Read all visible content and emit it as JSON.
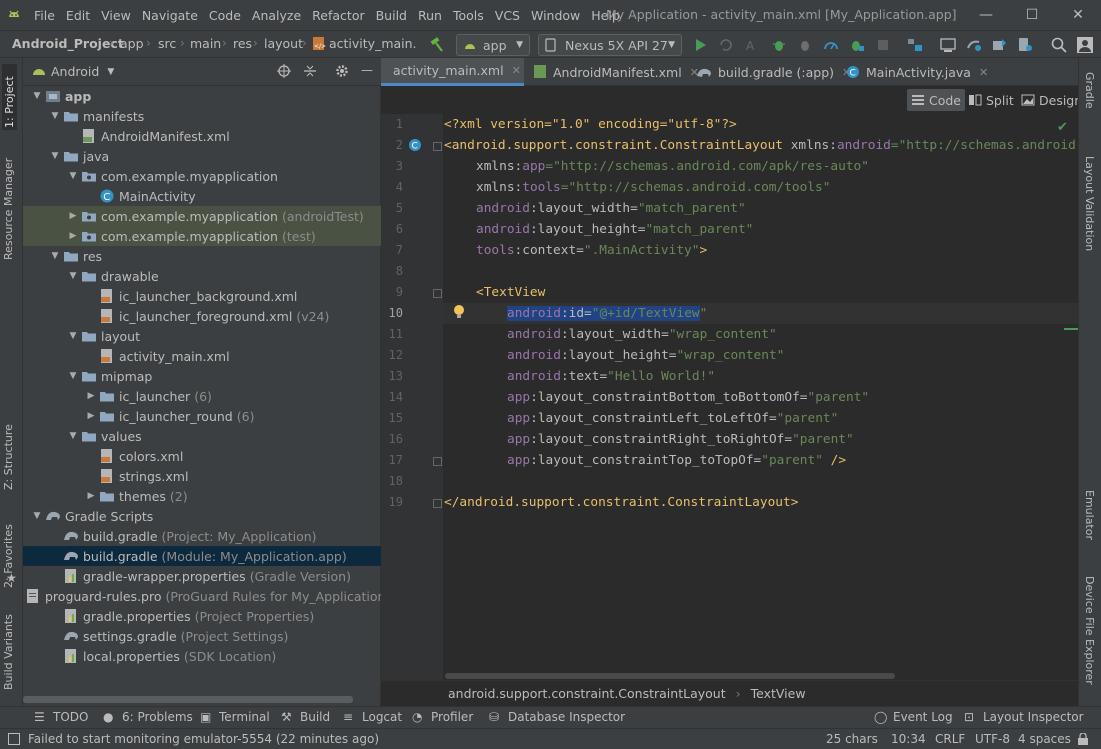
{
  "menu": [
    "File",
    "Edit",
    "View",
    "Navigate",
    "Code",
    "Analyze",
    "Refactor",
    "Build",
    "Run",
    "Tools",
    "VCS",
    "Window",
    "Help"
  ],
  "window_title": "My Application - activity_main.xml [My_Application.app]",
  "window_controls": {
    "minimize": "—",
    "maximize": "☐",
    "close": "✕"
  },
  "breadcrumb": [
    "Android_Project",
    "app",
    "src",
    "main",
    "res",
    "layout",
    "activity_main.xml"
  ],
  "run_config": "app",
  "device": "Nexus 5X API 27",
  "project_view": "Android",
  "left_tabs": [
    "1: Project",
    "Resource Manager",
    "Z: Structure",
    "2: Favorites",
    "Build Variants"
  ],
  "right_tabs": [
    "Gradle",
    "Layout Validation",
    "Emulator",
    "Device File Explorer"
  ],
  "tree": [
    {
      "label": "app",
      "suffix": "",
      "icon": "module",
      "expanded": true
    },
    {
      "label": "manifests",
      "suffix": "",
      "icon": "folder",
      "expanded": true
    },
    {
      "label": "AndroidManifest.xml",
      "suffix": "",
      "icon": "manifest"
    },
    {
      "label": "java",
      "suffix": "",
      "icon": "folder",
      "expanded": true
    },
    {
      "label": "com.example.myapplication",
      "suffix": "",
      "icon": "package",
      "expanded": true
    },
    {
      "label": "MainActivity",
      "suffix": "",
      "icon": "class"
    },
    {
      "label": "com.example.myapplication",
      "suffix": "(androidTest)",
      "icon": "package",
      "expanded": false
    },
    {
      "label": "com.example.myapplication",
      "suffix": "(test)",
      "icon": "package",
      "expanded": false
    },
    {
      "label": "res",
      "suffix": "",
      "icon": "folder",
      "expanded": true
    },
    {
      "label": "drawable",
      "suffix": "",
      "icon": "folder",
      "expanded": true
    },
    {
      "label": "ic_launcher_background.xml",
      "suffix": "",
      "icon": "xml"
    },
    {
      "label": "ic_launcher_foreground.xml",
      "suffix": "(v24)",
      "icon": "xml"
    },
    {
      "label": "layout",
      "suffix": "",
      "icon": "folder",
      "expanded": true
    },
    {
      "label": "activity_main.xml",
      "suffix": "",
      "icon": "xml"
    },
    {
      "label": "mipmap",
      "suffix": "",
      "icon": "folder",
      "expanded": true
    },
    {
      "label": "ic_launcher",
      "suffix": "(6)",
      "icon": "folder",
      "expanded": false
    },
    {
      "label": "ic_launcher_round",
      "suffix": "(6)",
      "icon": "folder",
      "expanded": false
    },
    {
      "label": "values",
      "suffix": "",
      "icon": "folder",
      "expanded": true
    },
    {
      "label": "colors.xml",
      "suffix": "",
      "icon": "xml"
    },
    {
      "label": "strings.xml",
      "suffix": "",
      "icon": "xml"
    },
    {
      "label": "themes",
      "suffix": "(2)",
      "icon": "folder",
      "expanded": false
    },
    {
      "label": "Gradle Scripts",
      "suffix": "",
      "icon": "gradle",
      "expanded": true
    },
    {
      "label": "build.gradle",
      "suffix": "(Project: My_Application)",
      "icon": "gradle"
    },
    {
      "label": "build.gradle",
      "suffix": "(Module: My_Application.app)",
      "icon": "gradle"
    },
    {
      "label": "gradle-wrapper.properties",
      "suffix": "(Gradle Version)",
      "icon": "props"
    },
    {
      "label": "proguard-rules.pro",
      "suffix": "(ProGuard Rules for My_Application",
      "icon": "file"
    },
    {
      "label": "gradle.properties",
      "suffix": "(Project Properties)",
      "icon": "props"
    },
    {
      "label": "settings.gradle",
      "suffix": "(Project Settings)",
      "icon": "gradle"
    },
    {
      "label": "local.properties",
      "suffix": "(SDK Location)",
      "icon": "props"
    }
  ],
  "editor_tabs": [
    {
      "label": "activity_main.xml",
      "active": true
    },
    {
      "label": "AndroidManifest.xml",
      "active": false
    },
    {
      "label": "build.gradle (:app)",
      "active": false
    },
    {
      "label": "MainActivity.java",
      "active": false
    }
  ],
  "editor_modes": [
    "Code",
    "Split",
    "Design"
  ],
  "code_lines": [
    "1",
    "2",
    "3",
    "4",
    "5",
    "6",
    "7",
    "8",
    "9",
    "10",
    "11",
    "12",
    "13",
    "14",
    "15",
    "16",
    "17",
    "18",
    "19"
  ],
  "code": {
    "pi": "<?xml version=\"1.0\" encoding=\"utf-8\"?>",
    "root_tag": "<android.support.constraint.ConstraintLayout",
    "root_xmlns": " xmlns:",
    "ns_android": "android",
    "eq_android": "=\"http://schemas.android.com/apk/res/android\"",
    "l3a": "xmlns:",
    "l3b": "app",
    "l3c": "=\"http://schemas.android.com/apk/res-auto\"",
    "l4a": "xmlns:",
    "l4b": "tools",
    "l4c": "=\"http://schemas.android.com/tools\"",
    "android": "android",
    "app": "app",
    "tools": "tools",
    "l5": ":layout_width=",
    "l5v": "\"match_parent\"",
    "l6": ":layout_height=",
    "l6v": "\"match_parent\"",
    "l7": ":context=",
    "l7v": "\".MainActivity\"",
    "l7e": ">",
    "l9": "<TextView",
    "l10": ":id=",
    "l10v1": "\"@+id/TextView",
    "l10v2": "\"",
    "l11": ":layout_width=",
    "l11v": "\"wrap_content\"",
    "l12": ":layout_height=",
    "l12v": "\"wrap_content\"",
    "l13": ":text=",
    "l13v": "\"Hello World!\"",
    "l14": ":layout_constraintBottom_toBottomOf=",
    "l14v": "\"parent\"",
    "l15": ":layout_constraintLeft_toLeftOf=",
    "l15v": "\"parent\"",
    "l16": ":layout_constraintRight_toRightOf=",
    "l16v": "\"parent\"",
    "l17": ":layout_constraintTop_toTopOf=",
    "l17v": "\"parent\"",
    "l17e": " />",
    "l19": "</android.support.constraint.ConstraintLayout>"
  },
  "editor_breadcrumb": [
    "android.support.constraint.ConstraintLayout",
    "TextView"
  ],
  "bottom_tools": [
    "TODO",
    "6: Problems",
    "Terminal",
    "Build",
    "Logcat",
    "Profiler",
    "Database Inspector",
    "Event Log",
    "Layout Inspector"
  ],
  "status": {
    "message": "Failed to start monitoring emulator-5554 (22 minutes ago)",
    "chars": "25 chars",
    "position": "10:34",
    "line_sep": "CRLF",
    "encoding": "UTF-8",
    "indent": "4 spaces"
  },
  "colors": {
    "accent": "#4a88c7",
    "selection": "#214283",
    "tag": "#e8bf6a",
    "namespace": "#9876aa",
    "value": "#6a8759"
  }
}
